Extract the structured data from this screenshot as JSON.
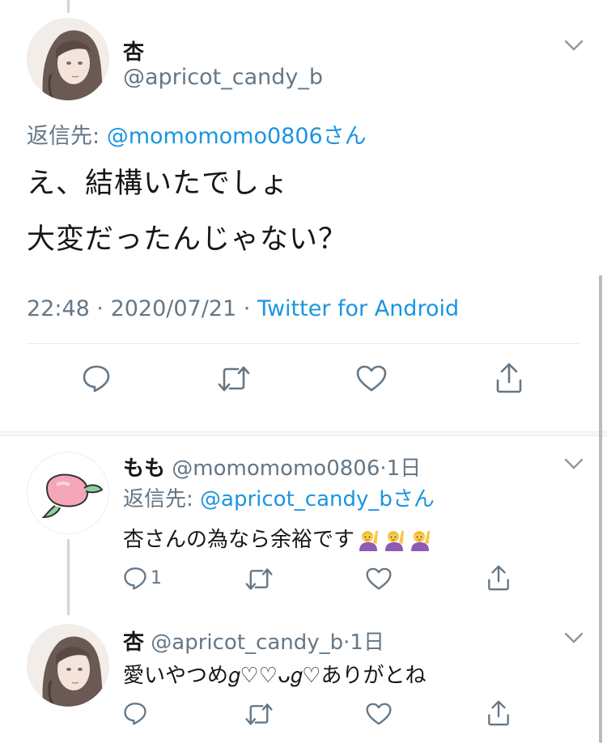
{
  "main_tweet": {
    "display_name": "杏",
    "handle": "@apricot_candy_b",
    "reply_to_prefix": "返信先: ",
    "reply_to_handle": "@momomomo0806さん",
    "text_line1": "え、結構いたでしょ",
    "text_line2": "大変だったんじゃない？",
    "time": "22:48",
    "sep1": " · ",
    "date": "2020/07/21",
    "sep2": " · ",
    "source": "Twitter for Android"
  },
  "reply1": {
    "display_name": "もも",
    "handle": "@momomomo0806",
    "age": "·1日",
    "reply_to_prefix": "返信先: ",
    "reply_to_handle": "@apricot_candy_bさん",
    "text": "杏さんの為なら余裕です",
    "emoji_count": 3,
    "reply_count": "1"
  },
  "reply2": {
    "display_name": "杏",
    "handle": "@apricot_candy_b",
    "age": "·1日",
    "text": "愛いやつめ𝑔⁧ᴗ𝑔♡ありがとね♡♡"
  },
  "colors": {
    "accent": "#1b95e0",
    "secondary_text": "#657786",
    "icon": "#657786",
    "divider": "#e6ecf0"
  },
  "icons": [
    "reply-icon",
    "retweet-icon",
    "like-icon",
    "share-icon",
    "chevron-down-icon"
  ]
}
